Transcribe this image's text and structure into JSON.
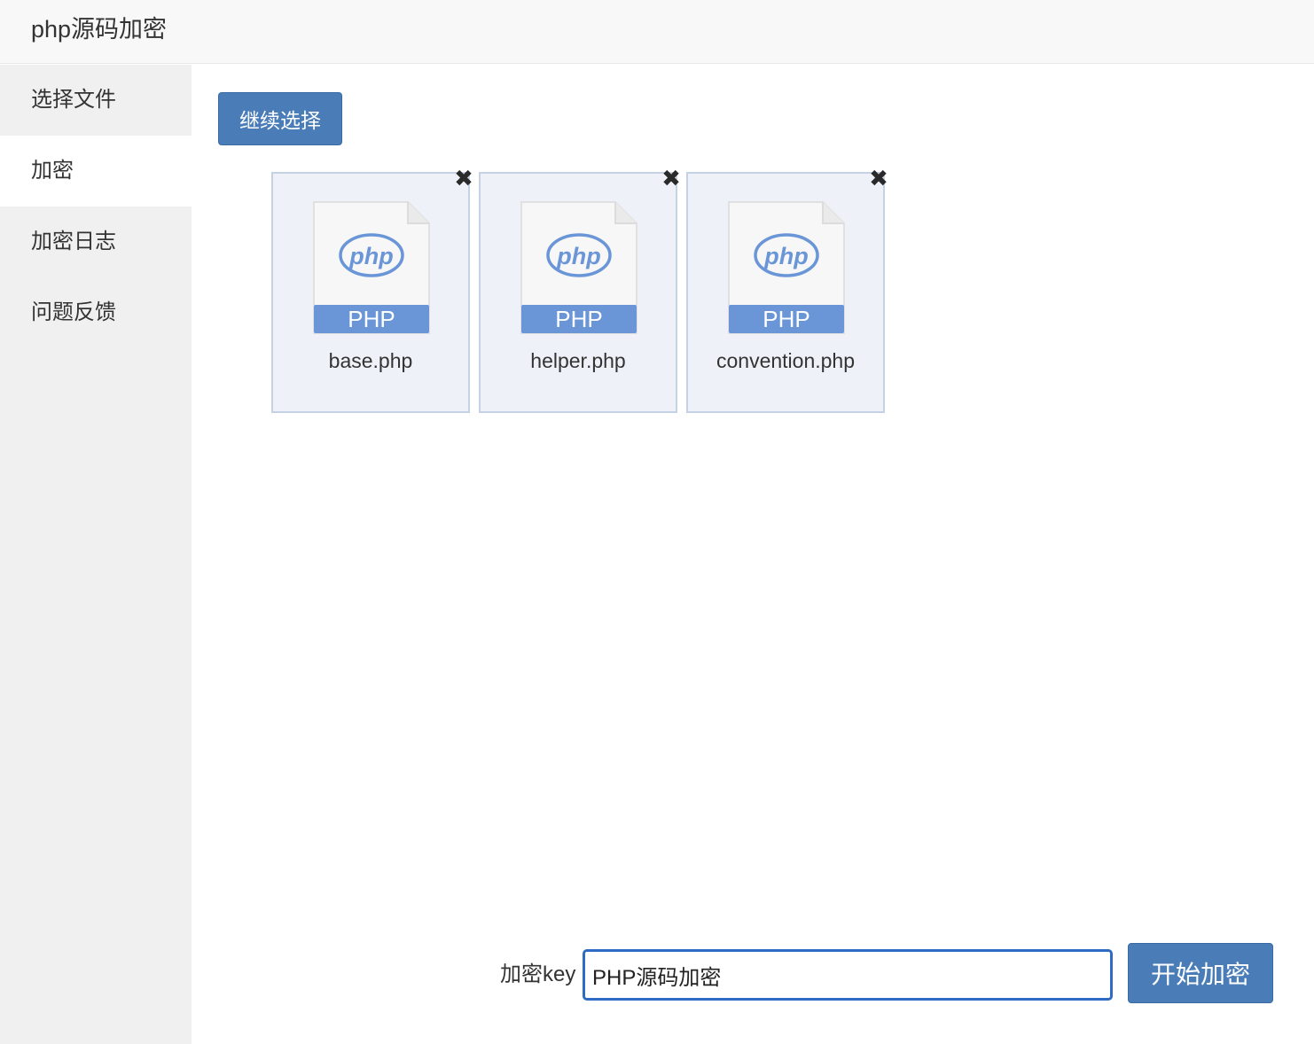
{
  "app": {
    "title": "php源码加密"
  },
  "sidebar": {
    "items": [
      {
        "label": "选择文件",
        "active": false
      },
      {
        "label": "加密",
        "active": true
      },
      {
        "label": "加密日志",
        "active": false
      },
      {
        "label": "问题反馈",
        "active": false
      }
    ]
  },
  "main": {
    "continue_button": "继续选择",
    "files": [
      {
        "name": "base.php",
        "badge": "PHP",
        "logo": "php",
        "icon": "php-file-icon",
        "remove_icon": "close-x-icon",
        "remove_glyph": "✖"
      },
      {
        "name": "helper.php",
        "badge": "PHP",
        "logo": "php",
        "icon": "php-file-icon",
        "remove_icon": "close-x-icon",
        "remove_glyph": "✖"
      },
      {
        "name": "convention.php",
        "badge": "PHP",
        "logo": "php",
        "icon": "php-file-icon",
        "remove_icon": "close-x-icon",
        "remove_glyph": "✖"
      }
    ],
    "key_label": "加密key",
    "key_value": "PHP源码加密",
    "start_button": "开始加密"
  },
  "colors": {
    "primary": "#4a7db8",
    "card_bg": "#eef2f8",
    "php_blue": "#6a96d8",
    "input_border": "#2f6bc5"
  }
}
